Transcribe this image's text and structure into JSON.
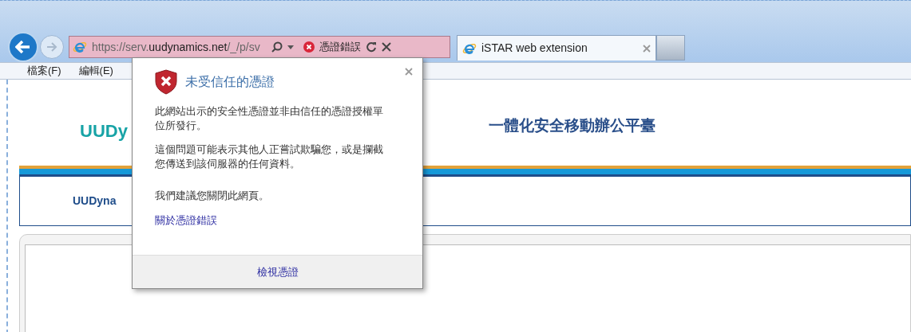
{
  "browser": {
    "address_bar": {
      "url": "https://serv.**uudynamics.net**/_/p/sv",
      "cert_error": "憑證錯誤"
    },
    "tabs": [
      {
        "label": "iSTAR web extension",
        "selected": true
      }
    ]
  },
  "menu": [
    "檔案(F)",
    "編輯(E)"
  ],
  "page": {
    "logo": "UUDy",
    "title": "一體化安全移動辦公平臺",
    "nav_text": "UUDyna"
  },
  "popup": {
    "title": "未受信任的憑證",
    "paragraphs": [
      "此網站出示的安全性憑證並非由信任的憑證授權單位所發行。",
      "這個問題可能表示其他人正嘗試欺騙您，或是攔截您傳送到該伺服器的任何資料。",
      "我們建議您關閉此網頁。"
    ],
    "link": "關於憑證錯誤",
    "button": "檢視憑證"
  }
}
